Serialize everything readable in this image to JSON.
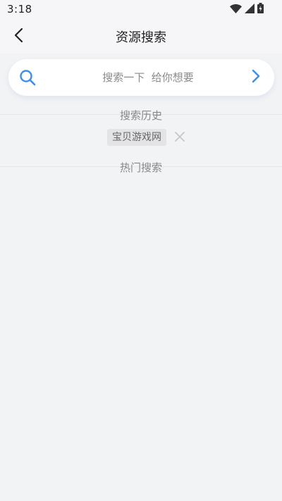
{
  "status_bar": {
    "time": "3:18",
    "icons": [
      "wifi-icon",
      "signal-icon",
      "battery-icon"
    ]
  },
  "header": {
    "back_icon": "back-arrow-icon",
    "title": "资源搜索"
  },
  "search": {
    "icon": "search-icon",
    "placeholder": "搜索一下  给你想要",
    "value": "",
    "submit_icon": "chevron-right-icon"
  },
  "history": {
    "title": "搜索历史",
    "items": [
      {
        "label": "宝贝游戏网"
      }
    ],
    "clear_icon": "close-icon"
  },
  "hot": {
    "title": "热门搜索",
    "items": []
  },
  "colors": {
    "accent": "#3b8ff0",
    "background": "#f2f3f5",
    "tag_bg": "#e4e4e6"
  }
}
